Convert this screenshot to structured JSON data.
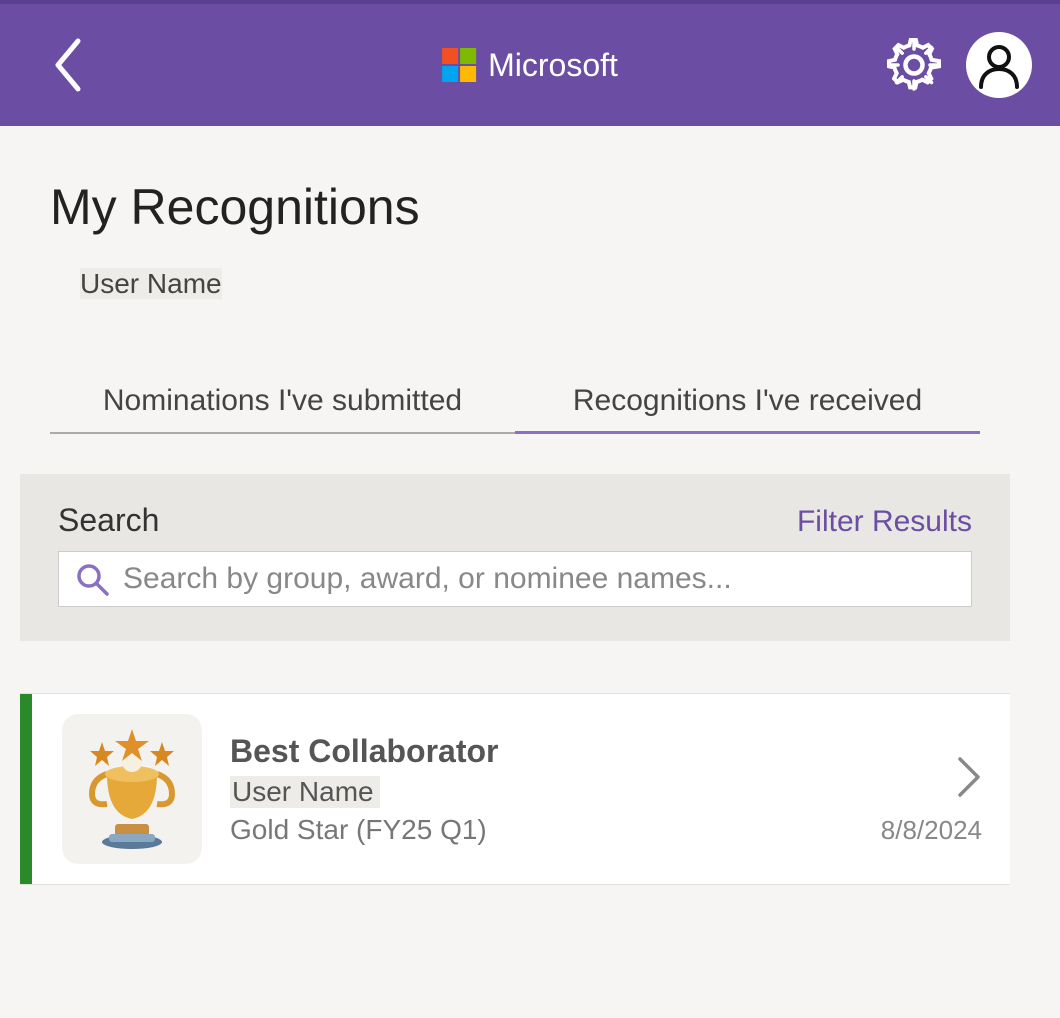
{
  "header": {
    "brand": "Microsoft"
  },
  "page": {
    "title": "My Recognitions",
    "user_name": "User Name"
  },
  "tabs": [
    {
      "label": "Nominations I've submitted",
      "active": false
    },
    {
      "label": "Recognitions I've received",
      "active": true
    }
  ],
  "search": {
    "label": "Search",
    "filter_label": "Filter Results",
    "placeholder": "Search by group, award, or nominee names..."
  },
  "cards": [
    {
      "title": "Best Collaborator",
      "user": "User Name",
      "group": "Gold Star (FY25 Q1)",
      "date": "8/8/2024",
      "stripe_color": "#2a8a2a"
    }
  ]
}
